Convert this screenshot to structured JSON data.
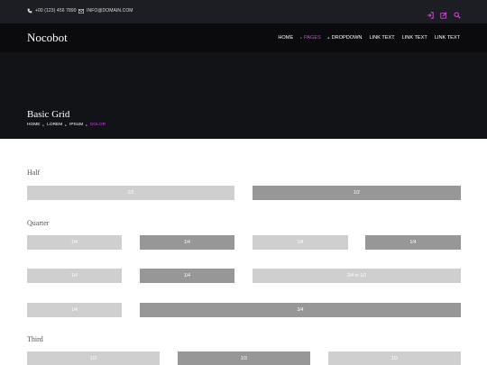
{
  "topbar": {
    "phone": "+00 (123) 456 7890",
    "email": "INFO@DOMAIN.COM",
    "icons": [
      "sign-in-icon",
      "edit-icon",
      "search-icon"
    ],
    "accent": "#c34bcb"
  },
  "navbar": {
    "brand": "Nocobot",
    "menu": [
      "HOME",
      "PAGES",
      "DROPDOWN",
      "LINK TEXT",
      "LINK TEXT",
      "LINK TEXT"
    ],
    "active": "PAGES"
  },
  "hero": {
    "title": "Basic Grid",
    "breadcrumb": [
      "HOME",
      "LOREM",
      "IPSUM",
      "DOLOR"
    ]
  },
  "sections": {
    "half": "Half",
    "quarter": "Quarter",
    "third": "Third"
  },
  "grid": {
    "half_1": "1/2",
    "half_2": "1/2",
    "q1_1": "1/4",
    "q1_2": "1/4",
    "q1_3": "1/4",
    "q1_4": "1/4",
    "q2_1": "1/4",
    "q2_2": "1/4",
    "q2_3": "2/4 or 1/2",
    "q3_1": "1/4",
    "q3_2": "3/4",
    "t_1": "1/3",
    "t_2": "1/3",
    "t_3": "1/3"
  }
}
